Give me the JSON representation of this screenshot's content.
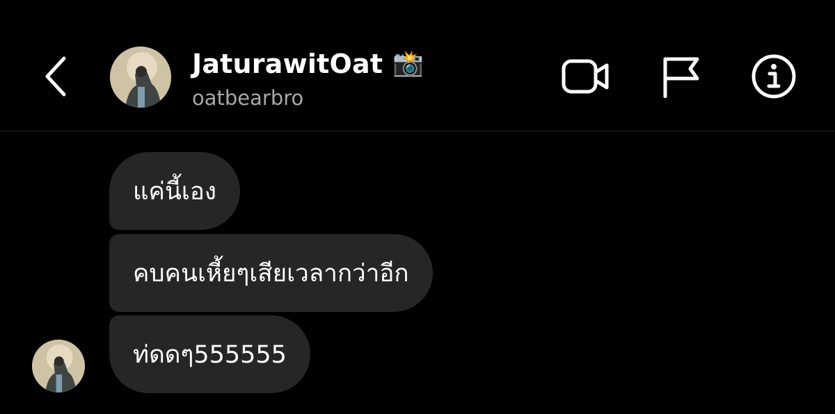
{
  "header": {
    "display_name": "JaturawitOat",
    "name_emoji": "📸",
    "username": "oatbearbro",
    "icons": {
      "back": "chevron-left-icon",
      "video_call": "video-camera-icon",
      "report": "flag-icon",
      "info": "info-icon"
    }
  },
  "messages": [
    {
      "sender": "other",
      "text": "แค่นี้เอง"
    },
    {
      "sender": "other",
      "text": "คบคนเหี้ยๆเสียเวลากว่าอีก"
    },
    {
      "sender": "other",
      "text": "ท่ดดๆ555555"
    }
  ],
  "colors": {
    "background": "#000000",
    "bubble": "#262626",
    "text_primary": "#ffffff",
    "text_secondary": "#a8a8a8",
    "divider": "#262626"
  }
}
